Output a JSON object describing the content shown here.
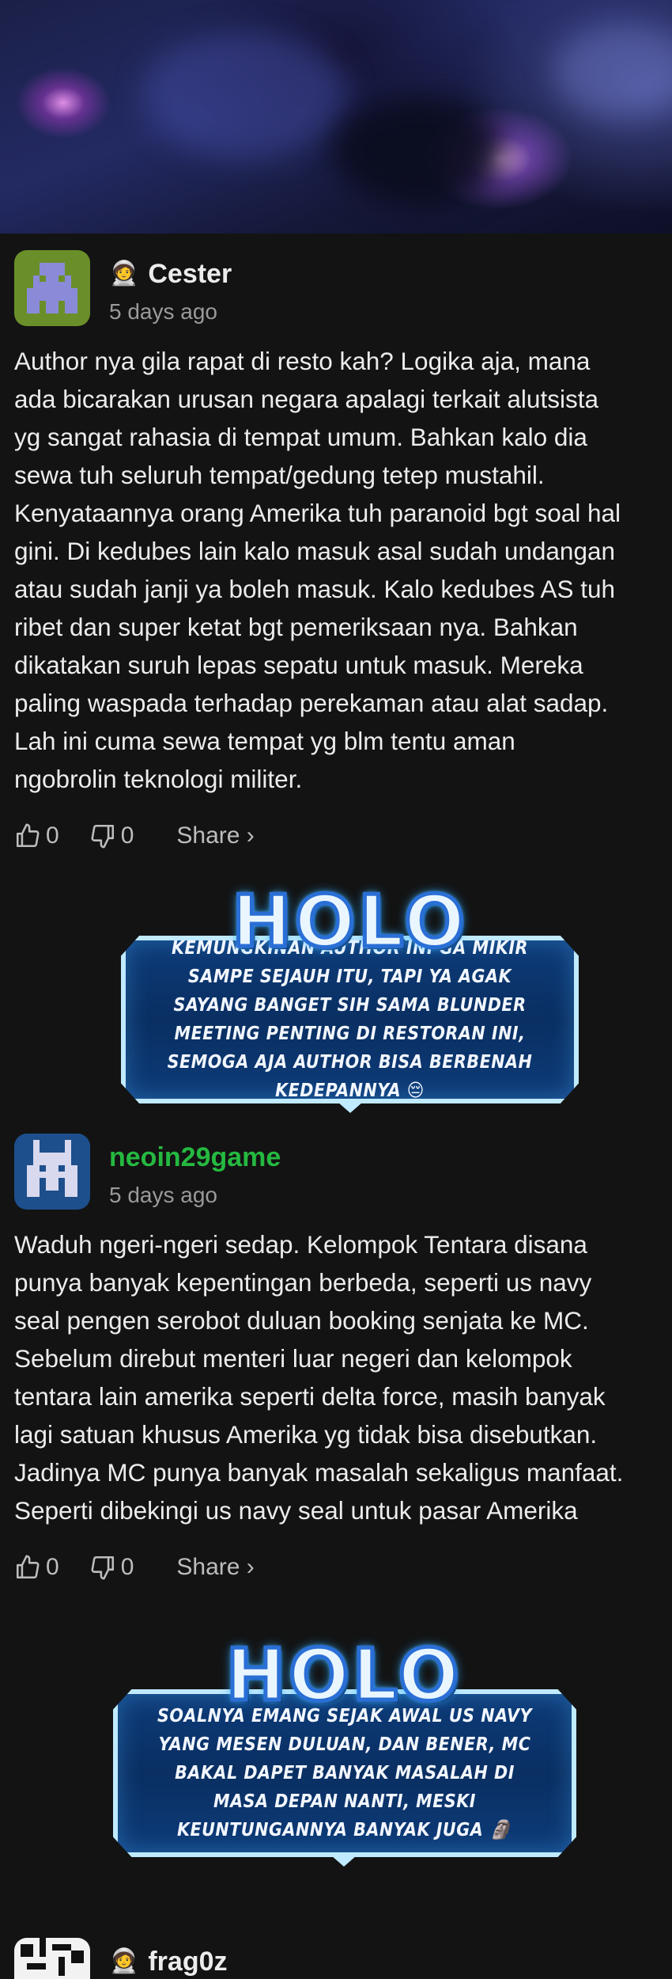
{
  "comments": [
    {
      "author": "Cester",
      "badge": "🧑‍🚀",
      "time": "5 days ago",
      "text": "Author nya gila rapat di resto kah? Logika aja, mana\nada bicarakan urusan negara apalagi terkait alutsista\nyg sangat rahasia di tempat umum. Bahkan kalo dia\nsewa tuh seluruh tempat/gedung tetep mustahil.\nKenyataannya orang Amerika tuh paranoid bgt soal hal\ngini. Di kedubes lain kalo masuk asal sudah undangan\natau sudah janji ya boleh masuk. Kalo kedubes AS tuh\nribet dan super ketat bgt pemeriksaan nya. Bahkan\ndikatakan suruh lepas sepatu untuk masuk. Mereka\npaling waspada terhadap perekaman atau alat sadap.\nLah ini cuma sewa tempat yg blm tentu aman\nngobrolin teknologi militer.",
      "likes": "0",
      "dislikes": "0",
      "share": "Share ›"
    },
    {
      "author": "neoin29game",
      "badge": "",
      "time": "5 days ago",
      "text": "Waduh ngeri-ngeri sedap. Kelompok Tentara disana\npunya banyak kepentingan berbeda, seperti us navy\nseal pengen serobot duluan booking senjata ke MC.\nSebelum direbut menteri luar negeri dan kelompok\ntentara lain amerika seperti delta force, masih banyak\nlagi satuan khusus Amerika yg tidak bisa disebutkan.\nJadinya MC punya banyak masalah sekaligus manfaat.\nSeperti dibekingi us navy seal untuk pasar Amerika",
      "likes": "0",
      "dislikes": "0",
      "share": "Share ›"
    },
    {
      "author": "frag0z",
      "badge": "🧑‍🚀"
    }
  ],
  "holo_cards": [
    {
      "logo": "HOLO",
      "text": "Kemungkinan author ini ga mikir sampe sejauh itu, tapi ya agak sayang banget sih sama blunder meeting penting di restoran ini, semoga aja author bisa berbenah kedepannya 😔"
    },
    {
      "logo": "HOLO",
      "text": "Soalnya emang sejak awal us navy yang mesen duluan, dan bener, MC bakal dapet banyak masalah di masa depan nanti, meski keuntungannya banyak juga 🗿"
    }
  ],
  "colors": {
    "background": "#131313",
    "text": "#ececec",
    "muted": "#9a9a9a",
    "green_username": "#25b940",
    "holo_blue": "#0d3b78"
  }
}
